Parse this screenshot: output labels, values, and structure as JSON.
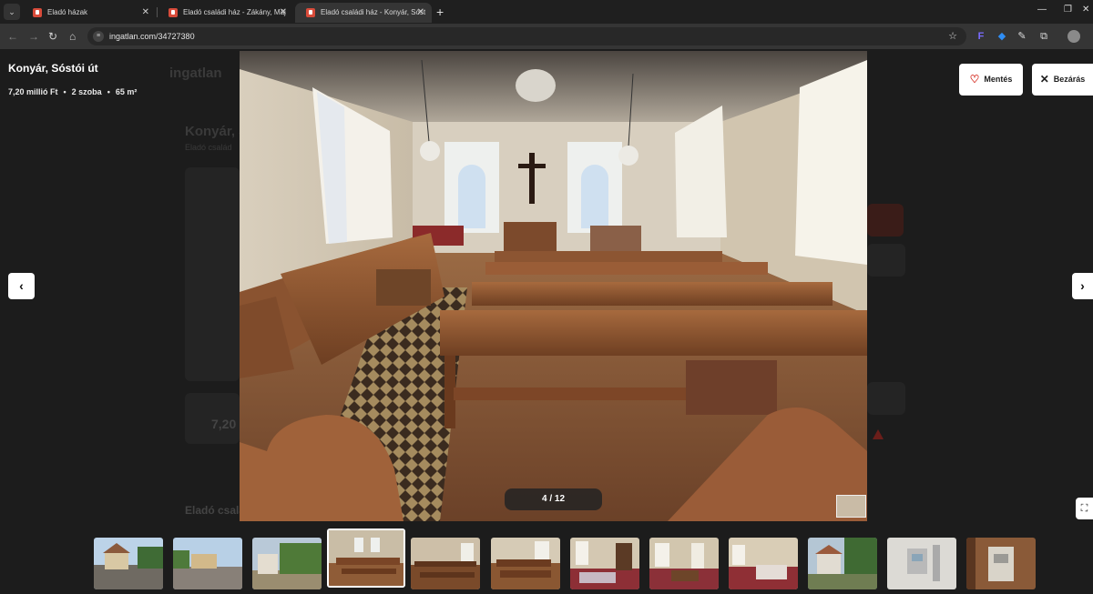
{
  "browser": {
    "tabs": [
      {
        "title": "Eladó házak",
        "active": false
      },
      {
        "title": "Eladó családi ház - Zákány, Máj",
        "active": false
      },
      {
        "title": "Eladó családi ház - Konyár, Sóst",
        "active": true
      }
    ],
    "url": "ingatlan.com/34727380"
  },
  "listing": {
    "title": "Konyár, Sóstói út",
    "price": "7,20 millió Ft",
    "rooms": "2 szoba",
    "area": "65 m²"
  },
  "actions": {
    "save_label": "Mentés",
    "close_label": "Bezárás"
  },
  "gallery": {
    "counter": "4 / 12",
    "active_index": 4,
    "thumbnail_count": 12
  },
  "background_page": {
    "title_fragment": "Konyár, S",
    "subtitle_fragment": "Eladó család",
    "price_fragment": "7,20",
    "section_heading": "Eladó csalá",
    "logo_fragment": "ingatlan"
  }
}
